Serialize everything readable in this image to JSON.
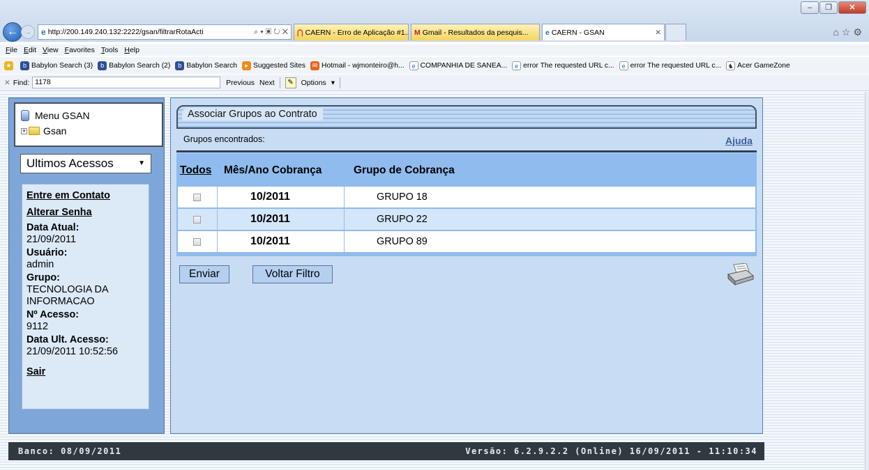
{
  "browser": {
    "address": "http://200.149.240.132:2222/gsan/filtrarRotaActi",
    "tabs": [
      {
        "label": "CAERN - Erro de Aplicação #1...",
        "icon": "caern-icon"
      },
      {
        "label": "Gmail - Resultados da pesquis...",
        "icon": "gmail-icon"
      },
      {
        "label": "CAERN - GSAN",
        "icon": "ie-icon",
        "active": true
      }
    ],
    "menu": [
      "File",
      "Edit",
      "View",
      "Favorites",
      "Tools",
      "Help"
    ],
    "favorites": [
      "Babylon Search (3)",
      "Babylon Search (2)",
      "Babylon Search",
      "Suggested Sites",
      "Hotmail - wjmonteiro@h...",
      "COMPANHIA DE SANEA...",
      "error The requested URL c...",
      "error The requested URL c...",
      "Acer GameZone"
    ],
    "find": {
      "label": "Find:",
      "value": "1178",
      "previous": "Previous",
      "next": "Next",
      "options": "Options"
    }
  },
  "sidebar": {
    "menu_title": "Menu GSAN",
    "tree_root": "Gsan",
    "recent_select": "Ultimos Acessos",
    "links": {
      "contact": "Entre em Contato",
      "password": "Alterar Senha",
      "logout": "Sair"
    },
    "info": [
      {
        "label": "Data Atual:",
        "value": "21/09/2011"
      },
      {
        "label": "Usuário:",
        "value": "admin"
      },
      {
        "label": "Grupo:",
        "value": "TECNOLOGIA DA INFORMACAO"
      },
      {
        "label": "Nº Acesso:",
        "value": "9112"
      },
      {
        "label": "Data Ult. Acesso:",
        "value": "21/09/2011 10:52:56"
      }
    ]
  },
  "main": {
    "title": "Associar Grupos ao Contrato",
    "found_label": "Grupos encontrados:",
    "help": "Ajuda",
    "columns": {
      "all": "Todos",
      "month": "Mês/Ano Cobrança",
      "group": "Grupo de Cobrança"
    },
    "rows": [
      {
        "month": "10/2011",
        "group": "GRUPO 18"
      },
      {
        "month": "10/2011",
        "group": "GRUPO 22"
      },
      {
        "month": "10/2011",
        "group": "GRUPO 89"
      }
    ],
    "buttons": {
      "send": "Enviar",
      "back": "Voltar Filtro"
    }
  },
  "status": {
    "bank": "Banco: 08/09/2011",
    "version": "Versão: 6.2.9.2.2 (Online) 16/09/2011 - 11:10:34"
  },
  "colors": {
    "panel": "#c8ddf3",
    "sidebar": "#7fa6d8",
    "statusbar": "#303940"
  }
}
